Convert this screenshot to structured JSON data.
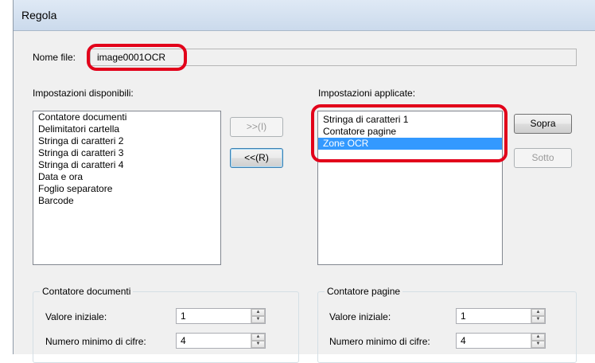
{
  "window": {
    "title": "Regola"
  },
  "file": {
    "label": "Nome file:",
    "value": "image0001OCR"
  },
  "available": {
    "label": "Impostazioni disponibili:",
    "items": [
      "Contatore documenti",
      "Delimitatori cartella",
      "Stringa di caratteri 2",
      "Stringa di caratteri 3",
      "Stringa di caratteri 4",
      "Data e ora",
      "Foglio separatore",
      "Barcode"
    ]
  },
  "applied": {
    "label": "Impostazioni applicate:",
    "items": [
      "Stringa di caratteri 1",
      "Contatore pagine",
      "Zone OCR"
    ],
    "selected_index": 2
  },
  "buttons": {
    "add": ">>(I)",
    "remove": "<<(R)",
    "up": "Sopra",
    "down": "Sotto"
  },
  "doc_counter": {
    "legend": "Contatore documenti",
    "initial_label": "Valore iniziale:",
    "initial_value": "1",
    "digits_label": "Numero minimo di cifre:",
    "digits_value": "4"
  },
  "page_counter": {
    "legend": "Contatore pagine",
    "initial_label": "Valore iniziale:",
    "initial_value": "1",
    "digits_label": "Numero minimo di cifre:",
    "digits_value": "4"
  },
  "colors": {
    "highlight": "#e2001a",
    "selection": "#3399ff"
  }
}
